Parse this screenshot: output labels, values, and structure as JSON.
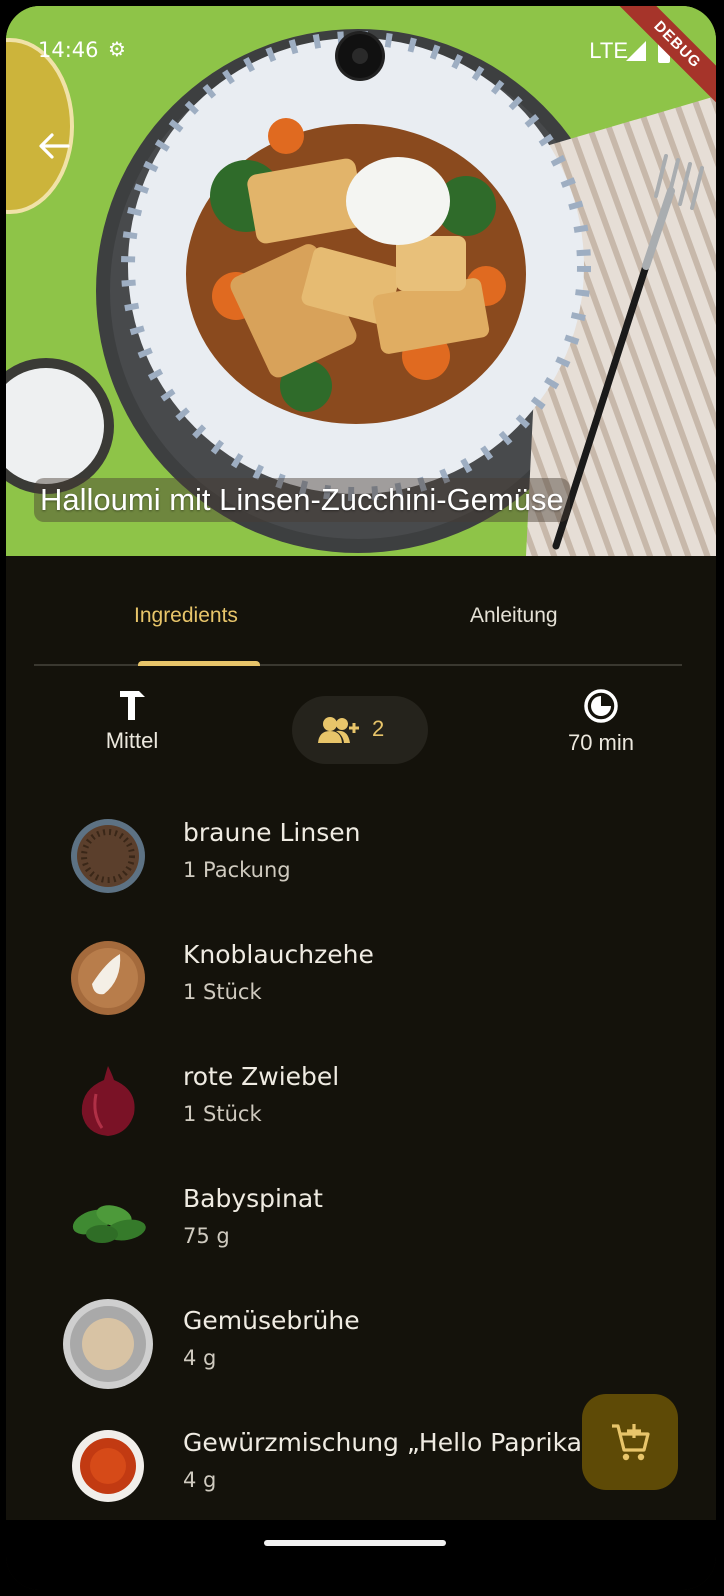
{
  "status_bar": {
    "time": "14:46",
    "network": "LTE",
    "debug_label": "DEBUG"
  },
  "recipe": {
    "title": "Halloumi mit Linsen-Zucchini-Gemüse"
  },
  "tabs": [
    {
      "label": "Ingredients",
      "active": true
    },
    {
      "label": "Anleitung",
      "active": false
    }
  ],
  "info": {
    "difficulty": "Mittel",
    "servings": "2",
    "duration": "70 min"
  },
  "ingredients": [
    {
      "name": "braune Linsen",
      "amount": "1 Packung",
      "icon": "lentils"
    },
    {
      "name": "Knoblauchzehe",
      "amount": "1 Stück",
      "icon": "garlic"
    },
    {
      "name": "rote Zwiebel",
      "amount": "1 Stück",
      "icon": "red-onion"
    },
    {
      "name": "Babyspinat",
      "amount": "75 g",
      "icon": "spinach"
    },
    {
      "name": "Gemüsebrühe",
      "amount": "4 g",
      "icon": "broth-powder"
    },
    {
      "name": "Gewürzmischung „Hello Paprika“",
      "amount": "4 g",
      "icon": "paprika-spice"
    }
  ],
  "colors": {
    "background": "#14120b",
    "accent": "#e8c56a",
    "fab": "#5e4a06"
  }
}
